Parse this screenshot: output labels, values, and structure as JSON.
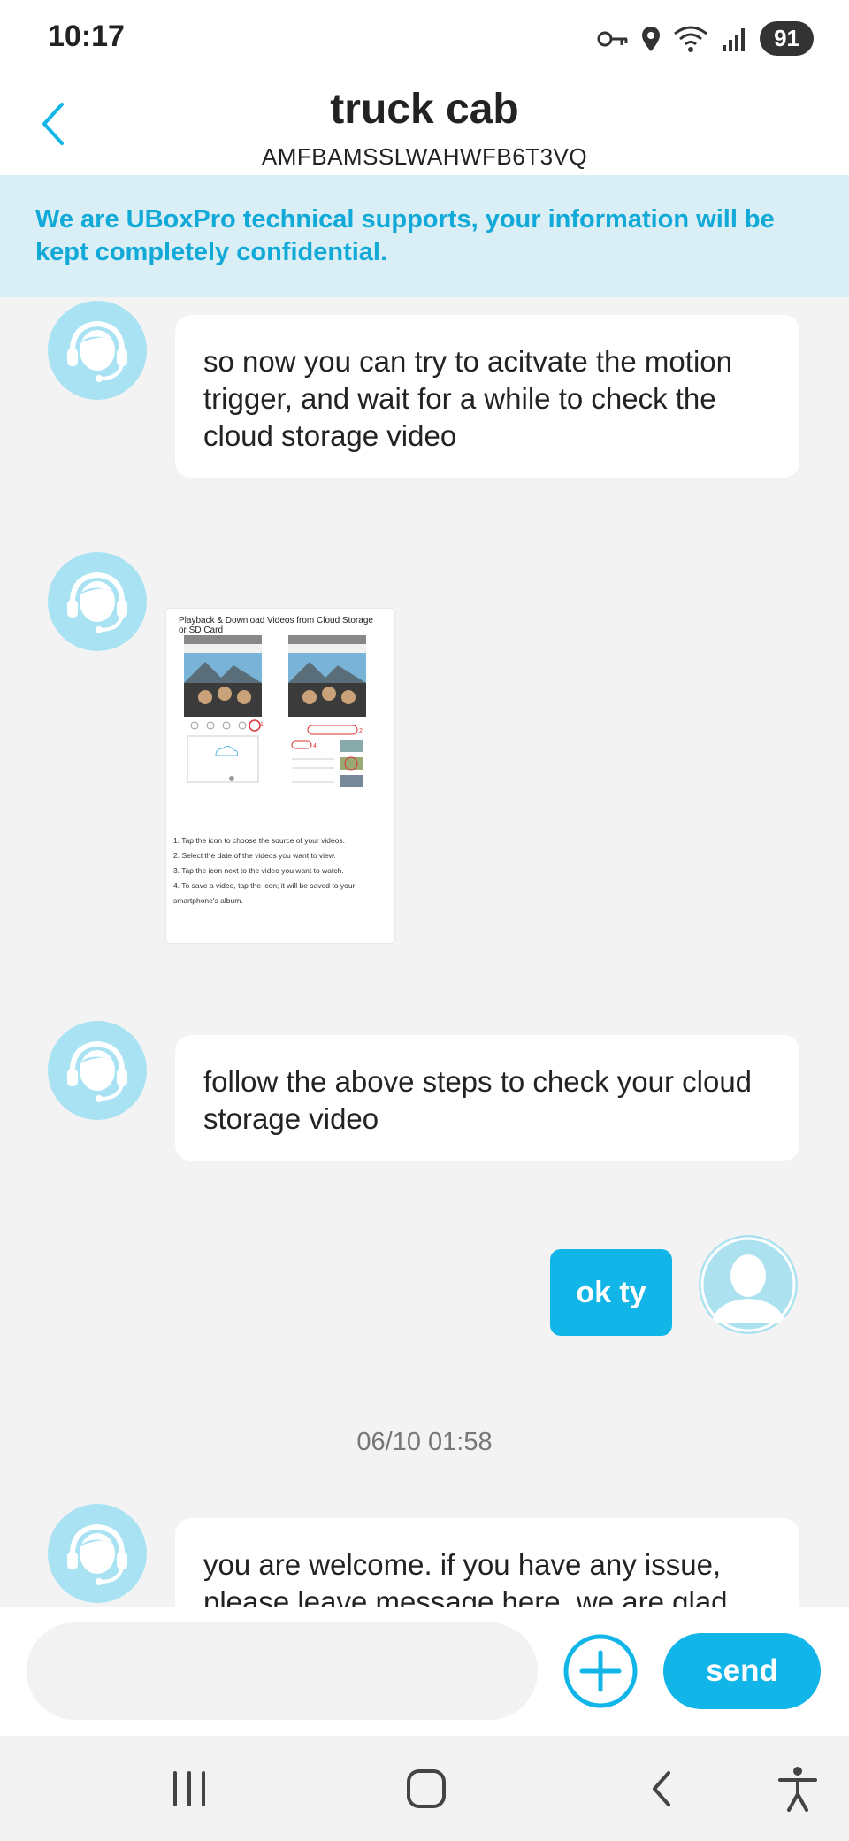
{
  "status_bar": {
    "time": "10:17",
    "battery": "91"
  },
  "header": {
    "title": "truck cab",
    "subtitle": "AMFBAMSSLWAHWFB6T3VQ"
  },
  "banner": {
    "text": "We are UBoxPro technical supports, your information will be kept completely confidential."
  },
  "messages": [
    {
      "from": "support",
      "type": "text",
      "text": "so now you can try to acitvate the motion trigger, and wait for a while to check the cloud storage video"
    },
    {
      "from": "support",
      "type": "image",
      "image": {
        "title": "Playback & Download Videos from Cloud Storage or SD Card",
        "steps": [
          "1. Tap the      icon to choose the source of your videos.",
          "2. Select the date of the videos you want to view.",
          "3. Tap the      icon next to the video you want to watch.",
          "4. To save a video, tap the      icon; it will be saved to your smartphone's album."
        ]
      }
    },
    {
      "from": "support",
      "type": "text",
      "text": "follow the above steps to check your cloud storage video"
    },
    {
      "from": "me",
      "type": "text",
      "text": "ok ty"
    },
    {
      "type": "timestamp",
      "text": "06/10 01:58"
    },
    {
      "from": "support",
      "type": "text",
      "text": "you are welcome. if you have any issue, please leave message here, we are glad"
    }
  ],
  "input": {
    "placeholder": "",
    "send_label": "send"
  },
  "icons": {
    "back": "chevron-left-icon",
    "plus": "plus-circle-icon",
    "avatar_support": "headset-agent-icon",
    "avatar_user": "user-silhouette-icon",
    "status": [
      "vpn-key-icon",
      "location-pin-icon",
      "wifi-icon",
      "signal-icon"
    ]
  },
  "colors": {
    "accent": "#12b5e8",
    "banner_bg": "#d9eef5",
    "banner_text": "#11a9d8",
    "avatar_bg": "#a9e3f3"
  }
}
